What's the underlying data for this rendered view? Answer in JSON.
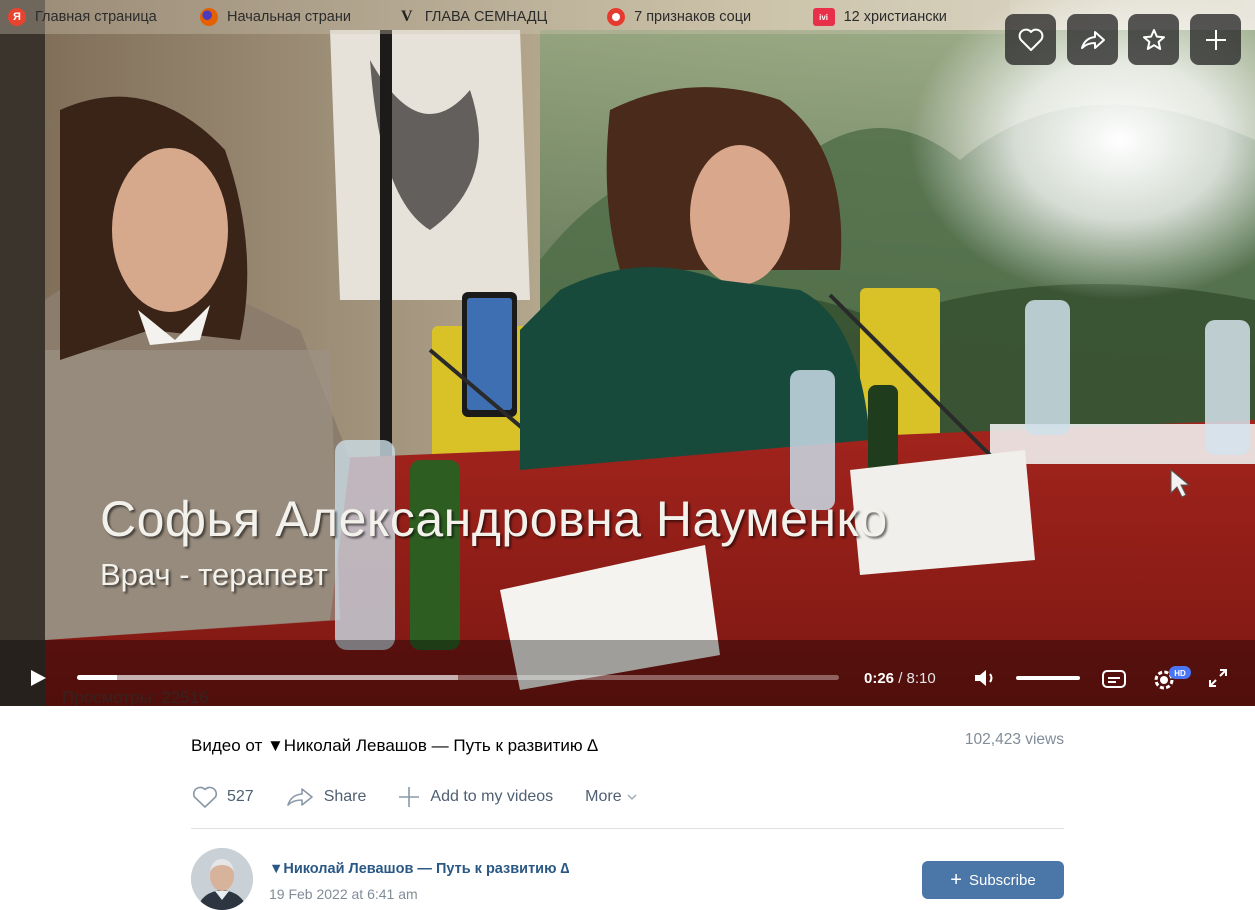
{
  "bookmarks": [
    {
      "label": "Главная страница",
      "icon": "yandex-icon",
      "color": "#e8432f",
      "glyph": "Я"
    },
    {
      "label": "Начальная страни",
      "icon": "firefox-icon",
      "color": "#e66000",
      "glyph": ""
    },
    {
      "label": "ГЛАВА СЕМНАДЦ",
      "icon": "v-icon",
      "color": "#222222",
      "glyph": "V"
    },
    {
      "label": "7 признаков соци",
      "icon": "ring-icon",
      "color": "#e53a2f",
      "glyph": ""
    },
    {
      "label": "12 христиански",
      "icon": "ivi-icon",
      "color": "#e8304a",
      "glyph": "ivi"
    }
  ],
  "overlay_buttons": [
    "heart-icon",
    "share-icon",
    "star-icon",
    "plus-icon"
  ],
  "video": {
    "caption_name": "Софья Александровна Науменко",
    "caption_role": "Врач - терапевт",
    "ghost_views": "Просмотры: 22516",
    "time_current": "0:26",
    "time_sep": " / ",
    "time_total": "8:10",
    "progress_played": 0.053,
    "progress_buffered": 0.5,
    "hd_badge": "HD"
  },
  "info": {
    "title": "Видео от ▼Николай Левашов — Путь к развитию ∆",
    "views": "102,423 views",
    "likes": "527",
    "share_label": "Share",
    "add_label": "Add to my videos",
    "more_label": "More",
    "author": "▼Николай Левашов — Путь к развитию ∆",
    "date": "19 Feb 2022 at 6:41 am",
    "subscribe_label": "Subscribe"
  },
  "colors": {
    "accent": "#4a76a8",
    "link": "#2a5885",
    "muted": "#818c99",
    "action": "#4f5f72"
  }
}
